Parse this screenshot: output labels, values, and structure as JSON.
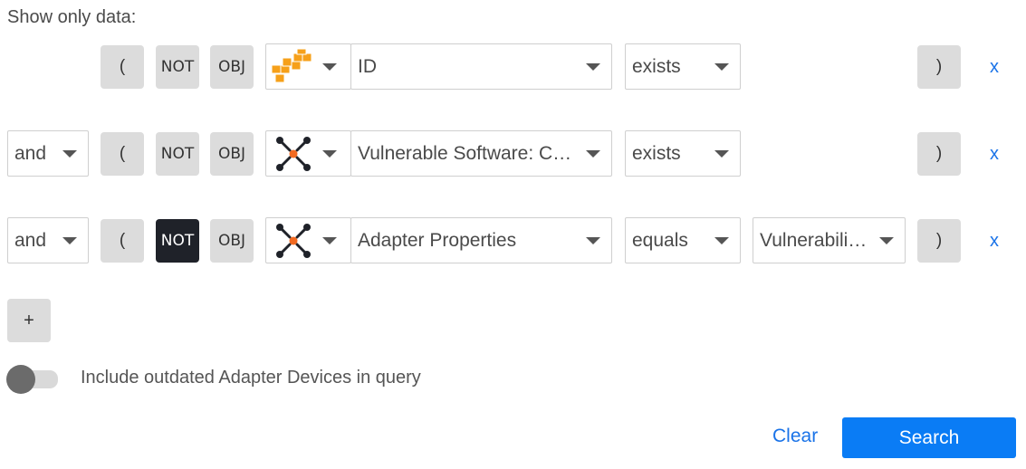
{
  "header": {
    "title": "Show only data:"
  },
  "rows": [
    {
      "connector": "",
      "open_paren": "(",
      "not_label": "NOT",
      "not_active": false,
      "obj_label": "OBJ",
      "adapter_icon": "aws-icon",
      "field": "ID",
      "operator": "exists",
      "value": "",
      "close_paren": ")",
      "remove": "x"
    },
    {
      "connector": "and",
      "open_paren": "(",
      "not_label": "NOT",
      "not_active": false,
      "obj_label": "OBJ",
      "adapter_icon": "axonius-icon",
      "field": "Vulnerable Software: C…",
      "operator": "exists",
      "value": "",
      "close_paren": ")",
      "remove": "x"
    },
    {
      "connector": "and",
      "open_paren": "(",
      "not_label": "NOT",
      "not_active": true,
      "obj_label": "OBJ",
      "adapter_icon": "axonius-icon",
      "field": "Adapter Properties",
      "operator": "equals",
      "value": "Vulnerabili…",
      "close_paren": ")",
      "remove": "x"
    }
  ],
  "add_label": "+",
  "toggle": {
    "label": "Include outdated Adapter Devices in query",
    "on": false
  },
  "footer": {
    "clear_label": "Clear",
    "search_label": "Search"
  },
  "colors": {
    "accent": "#0a7cf5",
    "link": "#1a73e8",
    "active_not": "#1f2229",
    "button_bg": "#dcdcdc"
  }
}
